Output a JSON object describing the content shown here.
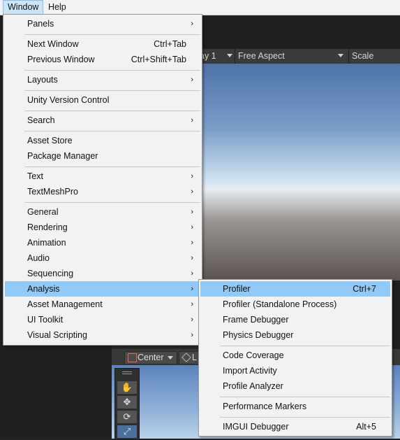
{
  "menubar": {
    "items": [
      "Window",
      "Help"
    ]
  },
  "game_toolbar": {
    "display": "ay 1",
    "aspect": "Free Aspect",
    "scale_label": "Scale"
  },
  "scene_toolbar": {
    "pivot": "Center",
    "space": "L"
  },
  "window_menu": {
    "items": [
      {
        "label": "Panels",
        "submenu": true
      },
      {
        "label": "Next Window",
        "shortcut": "Ctrl+Tab"
      },
      {
        "label": "Previous Window",
        "shortcut": "Ctrl+Shift+Tab"
      },
      {
        "label": "Layouts",
        "submenu": true
      },
      {
        "label": "Unity Version Control"
      },
      {
        "label": "Search",
        "submenu": true
      },
      {
        "label": "Asset Store"
      },
      {
        "label": "Package Manager"
      },
      {
        "label": "Text",
        "submenu": true
      },
      {
        "label": "TextMeshPro",
        "submenu": true
      },
      {
        "label": "General",
        "submenu": true
      },
      {
        "label": "Rendering",
        "submenu": true
      },
      {
        "label": "Animation",
        "submenu": true
      },
      {
        "label": "Audio",
        "submenu": true
      },
      {
        "label": "Sequencing",
        "submenu": true
      },
      {
        "label": "Analysis",
        "submenu": true,
        "highlighted": true
      },
      {
        "label": "Asset Management",
        "submenu": true
      },
      {
        "label": "UI Toolkit",
        "submenu": true
      },
      {
        "label": "Visual Scripting",
        "submenu": true
      }
    ]
  },
  "analysis_menu": {
    "items": [
      {
        "label": "Profiler",
        "shortcut": "Ctrl+7",
        "highlighted": true
      },
      {
        "label": "Profiler (Standalone Process)"
      },
      {
        "label": "Frame Debugger"
      },
      {
        "label": "Physics Debugger"
      },
      {
        "label": "Code Coverage"
      },
      {
        "label": "Import Activity"
      },
      {
        "label": "Profile Analyzer"
      },
      {
        "label": "Performance Markers"
      },
      {
        "label": "IMGUI Debugger",
        "shortcut": "Alt+5"
      }
    ]
  },
  "colors": {
    "menu_bg": "#f2f2f2",
    "highlight": "#91c9f7",
    "editor_dark": "#1f1f1f"
  }
}
